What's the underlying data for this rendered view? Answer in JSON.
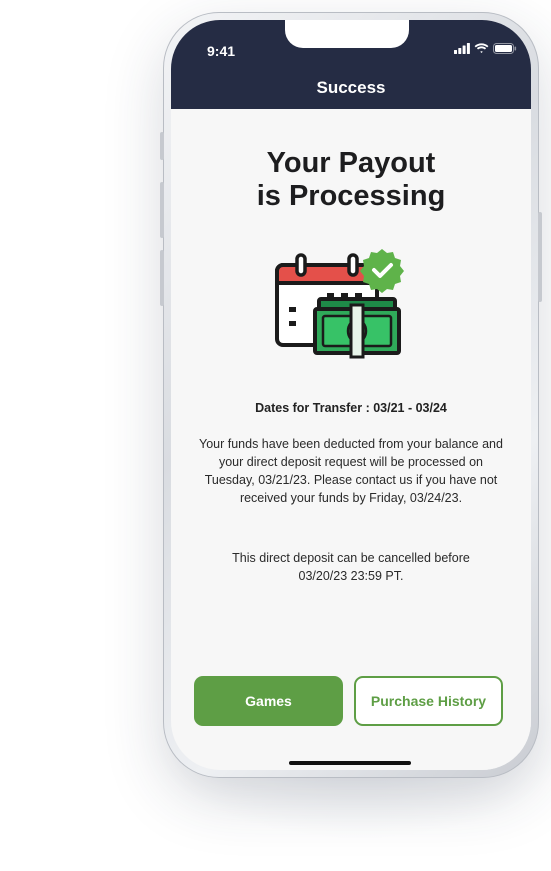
{
  "status_bar": {
    "time": "9:41",
    "icons": [
      "signal-icon",
      "wifi-icon",
      "battery-icon"
    ]
  },
  "header": {
    "title": "Success"
  },
  "main": {
    "title_line1": "Your Payout",
    "title_line2": "is Processing",
    "illustration": "calendar-money-check-icon",
    "dates": "Dates for Transfer : 03/21 - 03/24",
    "paragraph1": "Your funds have been deducted from your balance and your direct deposit request will be processed on Tuesday, 03/21/23. Please contact us if you have not received your funds by Friday, 03/24/23.",
    "paragraph2": "This direct deposit can be cancelled before 03/20/23 23:59 PT."
  },
  "buttons": {
    "games": "Games",
    "purchase_history": "Purchase History"
  },
  "colors": {
    "header_bg": "#252c44",
    "accent_green": "#5e9e45",
    "calendar_red": "#e4504a",
    "money_green": "#2faa5a"
  }
}
